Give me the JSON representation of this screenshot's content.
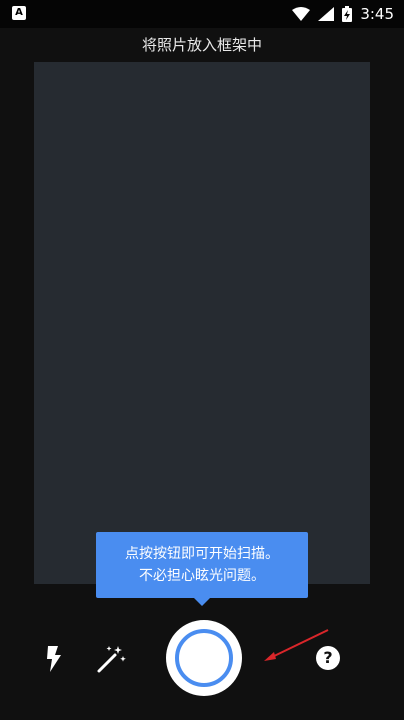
{
  "status_bar": {
    "left_icon_letter": "A",
    "time": "3:45"
  },
  "header": {
    "title": "将照片放入框架中"
  },
  "tooltip": {
    "line1": "点按按钮即可开始扫描。",
    "line2": "不必担心眩光问题。"
  },
  "controls": {
    "help_glyph": "?"
  },
  "colors": {
    "accent": "#4a8df0",
    "frame": "#262b31",
    "background": "#101010",
    "annotation_arrow": "#d9262a"
  }
}
